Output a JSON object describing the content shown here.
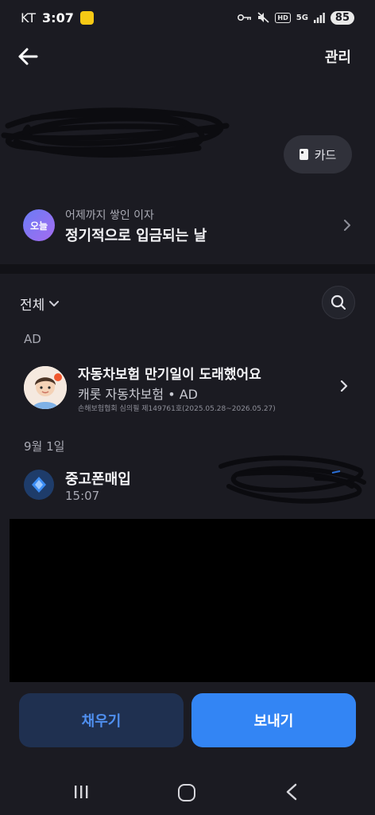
{
  "status_bar": {
    "carrier": "KT",
    "time": "3:07",
    "network": "5G",
    "hd": "HD",
    "battery": "85"
  },
  "header": {
    "back_icon": "arrow-left-icon",
    "manage_label": "관리"
  },
  "account": {
    "card_button_label": "카드"
  },
  "interest": {
    "badge": "오늘",
    "subtitle": "어제까지 쌓인 이자",
    "title": "정기적으로 입금되는 날"
  },
  "filter": {
    "label": "전체",
    "search_icon": "search-icon"
  },
  "ad": {
    "section_label": "AD",
    "title": "자동차보험 만기일이 도래했어요",
    "subtitle": "캐롯 자동차보험 • AD",
    "fine_print": "손해보험협회 심의필 제149761호(2025.05.28~2026.05.27)"
  },
  "transactions": {
    "date": "9월 1일",
    "items": [
      {
        "name": "중고폰매입",
        "time": "15:07"
      }
    ]
  },
  "actions": {
    "fill_label": "채우기",
    "send_label": "보내기"
  },
  "colors": {
    "background": "#1b1b22",
    "accent": "#3385f4",
    "fill_button_bg": "#1f3050",
    "fill_button_text": "#4f8fef"
  }
}
